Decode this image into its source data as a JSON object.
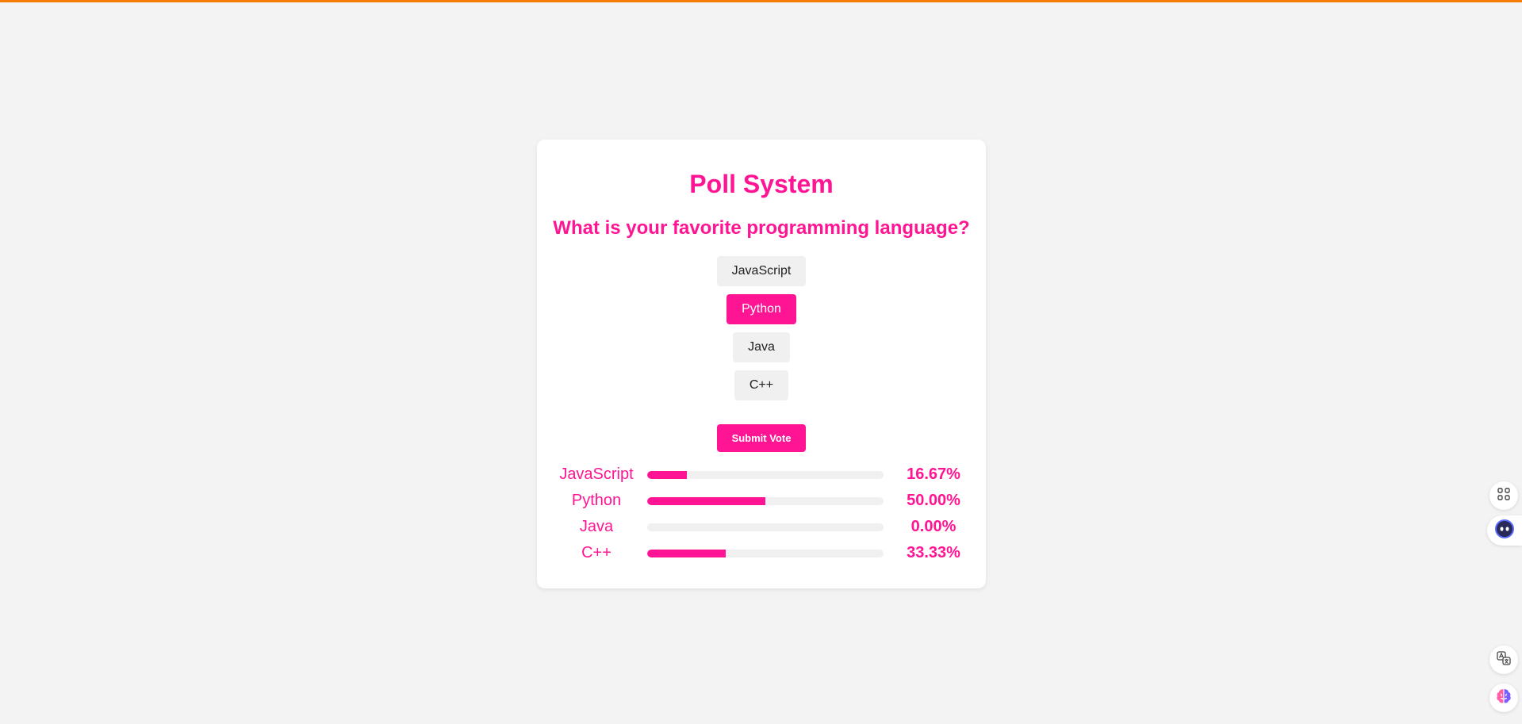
{
  "title": "Poll System",
  "question": "What is your favorite programming language?",
  "options": [
    {
      "label": "JavaScript",
      "selected": false
    },
    {
      "label": "Python",
      "selected": true
    },
    {
      "label": "Java",
      "selected": false
    },
    {
      "label": "C++",
      "selected": false
    }
  ],
  "submit_label": "Submit Vote",
  "results": [
    {
      "label": "JavaScript",
      "percent_text": "16.67%",
      "fraction": 0.1667
    },
    {
      "label": "Python",
      "percent_text": "50.00%",
      "fraction": 0.5
    },
    {
      "label": "Java",
      "percent_text": "0.00%",
      "fraction": 0.0
    },
    {
      "label": "C++",
      "percent_text": "33.33%",
      "fraction": 0.3333
    }
  ],
  "colors": {
    "accent": "#ff1493",
    "top_accent": "#f57c00",
    "background": "#f3f3f3",
    "option_bg": "#f0f0f0"
  },
  "side_icons": [
    "apps-grid-icon",
    "assistant-face-icon",
    "translate-icon",
    "ai-brain-icon"
  ]
}
